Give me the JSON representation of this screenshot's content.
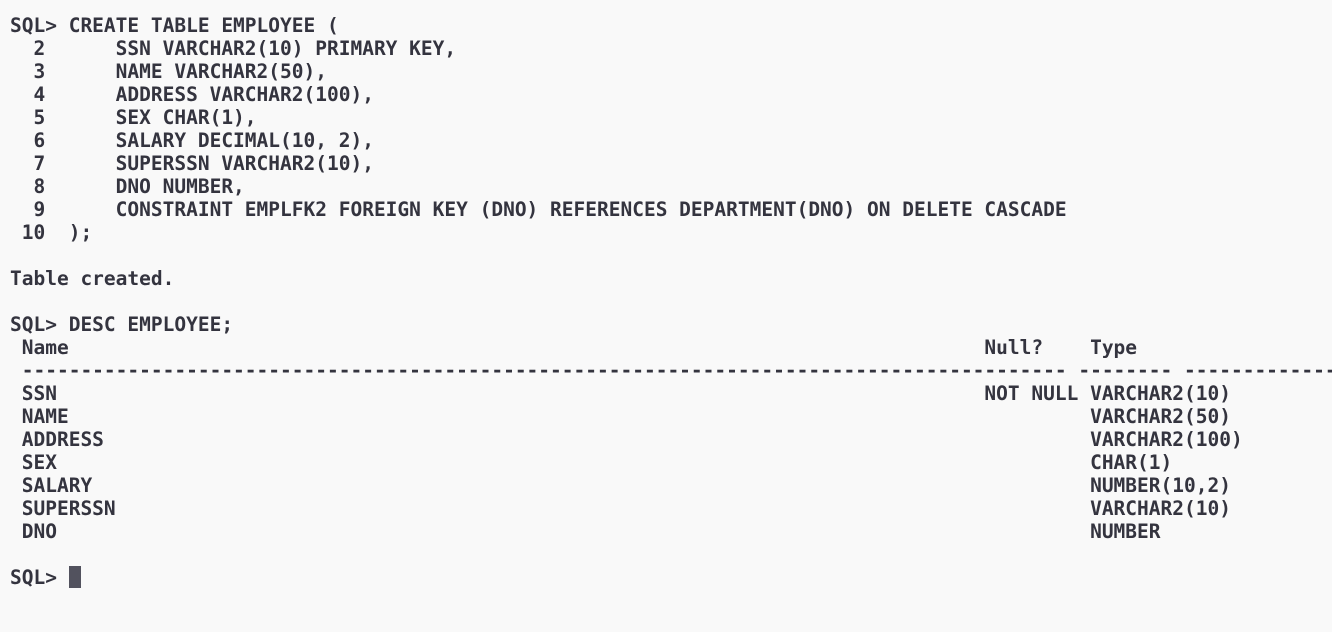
{
  "terminal": {
    "lines": [
      "SQL> CREATE TABLE EMPLOYEE (",
      "  2      SSN VARCHAR2(10) PRIMARY KEY,",
      "  3      NAME VARCHAR2(50),",
      "  4      ADDRESS VARCHAR2(100),",
      "  5      SEX CHAR(1),",
      "  6      SALARY DECIMAL(10, 2),",
      "  7      SUPERSSN VARCHAR2(10),",
      "  8      DNO NUMBER,",
      "  9      CONSTRAINT EMPLFK2 FOREIGN KEY (DNO) REFERENCES DEPARTMENT(DNO) ON DELETE CASCADE",
      " 10  );",
      "",
      "Table created.",
      "",
      "SQL> DESC EMPLOYEE;",
      " Name                                                                              Null?    Type",
      " ----------------------------------------------------------------------------------------- -------- ----------------------------",
      " SSN                                                                               NOT NULL VARCHAR2(10)",
      " NAME                                                                                       VARCHAR2(50)",
      " ADDRESS                                                                                    VARCHAR2(100)",
      " SEX                                                                                        CHAR(1)",
      " SALARY                                                                                     NUMBER(10,2)",
      " SUPERSSN                                                                                   VARCHAR2(10)",
      " DNO                                                                                        NUMBER",
      ""
    ],
    "prompt": "SQL> "
  },
  "colors": {
    "background": "#f9f9f9",
    "text": "#34343f",
    "cursor": "#52525e"
  }
}
